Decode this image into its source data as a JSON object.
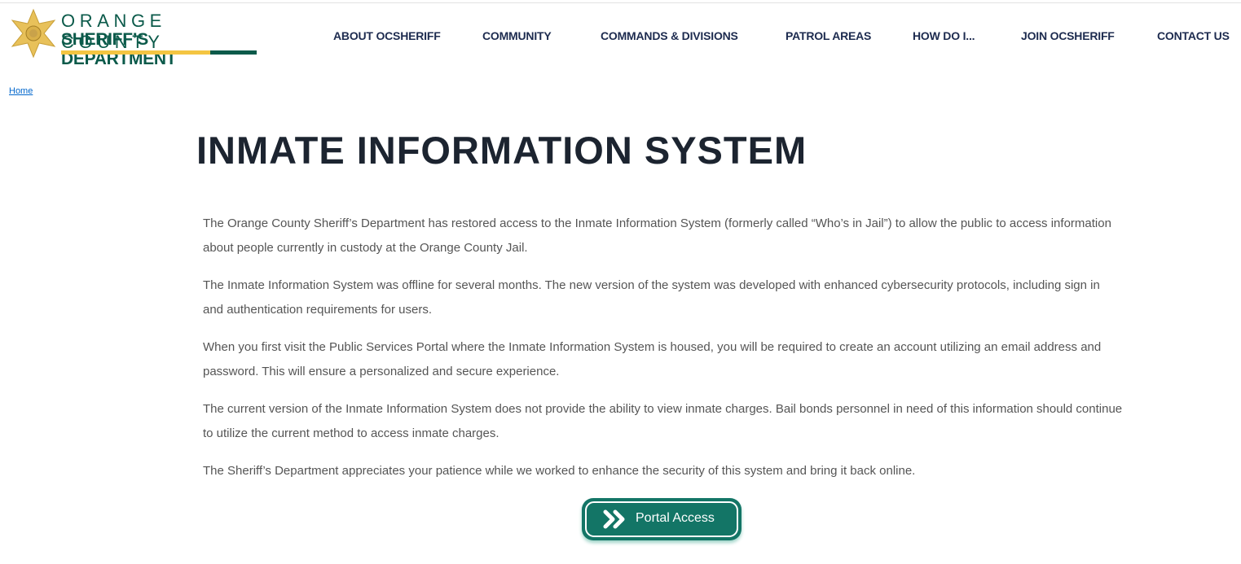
{
  "logo": {
    "line1": "ORANGE COUNTY",
    "line2": "SHERIFF’S DEPARTMENT",
    "colors": {
      "green": "#0b5a4a",
      "gold": "#f4c542"
    }
  },
  "nav": [
    "ABOUT OCSHERIFF",
    "COMMUNITY",
    "COMMANDS & DIVISIONS",
    "PATROL AREAS",
    "HOW DO I...",
    "JOIN OCSHERIFF",
    "CONTACT US"
  ],
  "breadcrumb": {
    "home": "Home"
  },
  "page": {
    "title": "INMATE INFORMATION SYSTEM",
    "paragraphs": [
      "The Orange County Sheriff’s Department has restored access to the Inmate Information System (formerly called “Who’s in Jail”) to allow the public to access information about people currently in custody at the Orange County Jail.",
      "The Inmate Information System was offline for several months. The new version of the system was developed with enhanced cybersecurity protocols, including sign in and authentication requirements for users.",
      "When you first visit the Public Services Portal where the Inmate Information System is housed, you will be required to create an account utilizing an email address and password. This will ensure a personalized and secure experience.",
      "The current version of the Inmate Information System does not provide the ability to view inmate charges. Bail bonds personnel in need of this information should continue to utilize the current method to access inmate charges.",
      "The Sheriff’s Department appreciates your patience while we worked to enhance the security of this system and bring it back online."
    ]
  },
  "portal_button": {
    "label": "Portal Access",
    "icon": "double-chevron-right-icon",
    "color": "#137566"
  }
}
